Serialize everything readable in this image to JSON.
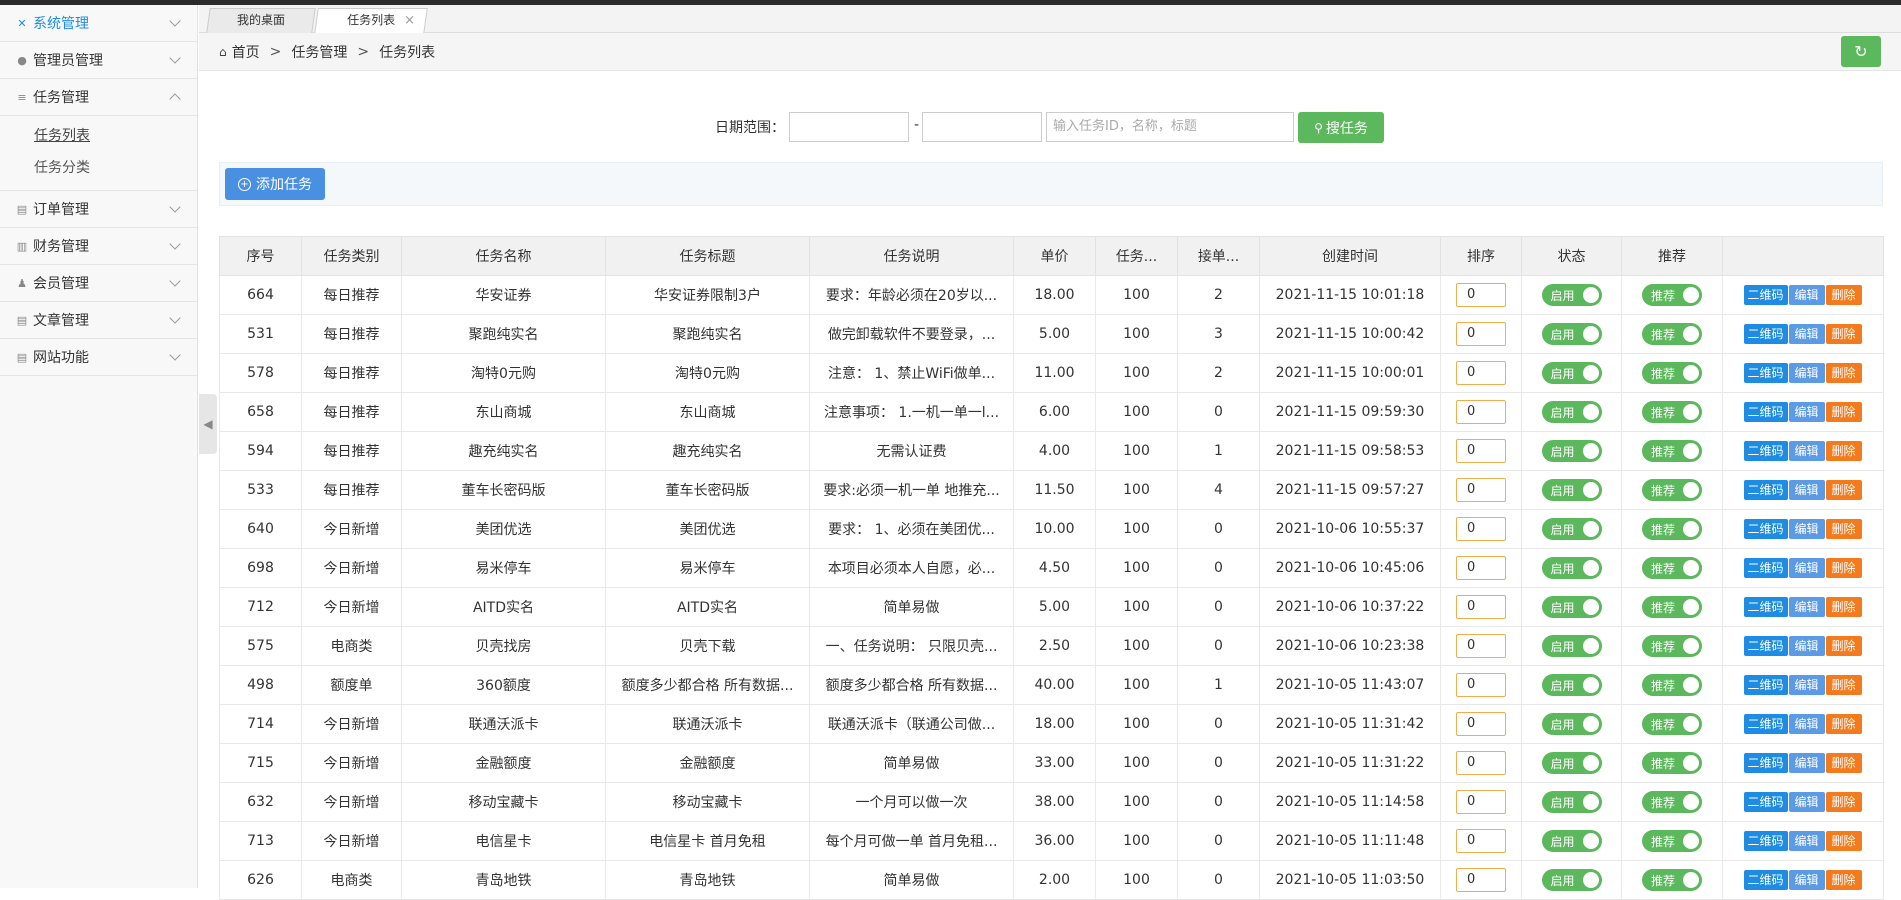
{
  "sidebar": {
    "items": [
      {
        "label": "系统管理",
        "icon": "wrench-icon",
        "expanded": false,
        "active": true
      },
      {
        "label": "管理员管理",
        "icon": "user-icon",
        "expanded": false
      },
      {
        "label": "任务管理",
        "icon": "database-icon",
        "expanded": true,
        "children": [
          {
            "label": "任务列表"
          },
          {
            "label": "任务分类"
          }
        ]
      },
      {
        "label": "订单管理",
        "icon": "table-icon",
        "expanded": false
      },
      {
        "label": "财务管理",
        "icon": "book-icon",
        "expanded": false
      },
      {
        "label": "会员管理",
        "icon": "users-icon",
        "expanded": false
      },
      {
        "label": "文章管理",
        "icon": "list-icon",
        "expanded": false
      },
      {
        "label": "网站功能",
        "icon": "list-icon",
        "expanded": false
      }
    ]
  },
  "tabs": [
    {
      "label": "我的桌面"
    },
    {
      "label": "任务列表",
      "close": "×"
    }
  ],
  "breadcrumb": {
    "home": "首页",
    "sep": ">",
    "section": "任务管理",
    "page": "任务列表"
  },
  "search": {
    "date_label": "日期范围：",
    "dash": "-",
    "keyword_placeholder": "输入任务ID，名称，标题",
    "button_label": "搜任务"
  },
  "toolbar": {
    "add_label": "添加任务"
  },
  "table": {
    "headers": [
      "序号",
      "任务类别",
      "任务名称",
      "任务标题",
      "任务说明",
      "单价",
      "任务...",
      "接单...",
      "创建时间",
      "排序",
      "状态",
      "推荐",
      ""
    ],
    "status_label": "启用",
    "recommend_label": "推荐",
    "actions": {
      "qr": "二维码",
      "edit": "编辑",
      "delete": "删除"
    },
    "rows": [
      [
        "664",
        "每日推荐",
        "华安证券",
        "华安证券限制3户",
        "要求：年龄必须在20岁以...",
        "18.00",
        "100",
        "2",
        "2021-11-15 10:01:18",
        "0"
      ],
      [
        "531",
        "每日推荐",
        "聚跑纯实名",
        "聚跑纯实名",
        "做完卸载软件不要登录，...",
        "5.00",
        "100",
        "3",
        "2021-11-15 10:00:42",
        "0"
      ],
      [
        "578",
        "每日推荐",
        "淘特0元购",
        "淘特0元购",
        "注意：  1、禁止WiFi做单...",
        "11.00",
        "100",
        "2",
        "2021-11-15 10:00:01",
        "0"
      ],
      [
        "658",
        "每日推荐",
        "东山商城",
        "东山商城",
        "注意事项：  1.一机一单一l...",
        "6.00",
        "100",
        "0",
        "2021-11-15 09:59:30",
        "0"
      ],
      [
        "594",
        "每日推荐",
        "趣充纯实名",
        "趣充纯实名",
        "无需认证费",
        "4.00",
        "100",
        "1",
        "2021-11-15 09:58:53",
        "0"
      ],
      [
        "533",
        "每日推荐",
        "董车长密码版",
        "董车长密码版",
        "要求:必须一机一单 地推充...",
        "11.50",
        "100",
        "4",
        "2021-11-15 09:57:27",
        "0"
      ],
      [
        "640",
        "今日新增",
        "美团优选",
        "美团优选",
        "要求：  1、必须在美团优...",
        "10.00",
        "100",
        "0",
        "2021-10-06 10:55:37",
        "0"
      ],
      [
        "698",
        "今日新增",
        "易米停车",
        "易米停车",
        "本项目必须本人自愿，必...",
        "4.50",
        "100",
        "0",
        "2021-10-06 10:45:06",
        "0"
      ],
      [
        "712",
        "今日新增",
        "AITD实名",
        "AITD实名",
        "简单易做",
        "5.00",
        "100",
        "0",
        "2021-10-06 10:37:22",
        "0"
      ],
      [
        "575",
        "电商类",
        "贝壳找房",
        "贝壳下载",
        "一、任务说明：  只限贝壳...",
        "2.50",
        "100",
        "0",
        "2021-10-06 10:23:38",
        "0"
      ],
      [
        "498",
        "额度单",
        "360额度",
        "额度多少都合格 所有数据...",
        "额度多少都合格 所有数据...",
        "40.00",
        "100",
        "1",
        "2021-10-05 11:43:07",
        "0"
      ],
      [
        "714",
        "今日新增",
        "联通沃派卡",
        "联通沃派卡",
        "联通沃派卡（联通公司做...",
        "18.00",
        "100",
        "0",
        "2021-10-05 11:31:42",
        "0"
      ],
      [
        "715",
        "今日新增",
        "金融额度",
        "金融额度",
        "简单易做",
        "33.00",
        "100",
        "0",
        "2021-10-05 11:31:22",
        "0"
      ],
      [
        "632",
        "今日新增",
        "移动宝藏卡",
        "移动宝藏卡",
        "一个月可以做一次",
        "38.00",
        "100",
        "0",
        "2021-10-05 11:14:58",
        "0"
      ],
      [
        "713",
        "今日新增",
        "电信星卡",
        "电信星卡 首月免租",
        "每个月可做一单 首月免租...",
        "36.00",
        "100",
        "0",
        "2021-10-05 11:11:48",
        "0"
      ],
      [
        "626",
        "电商类",
        "青岛地铁",
        "青岛地铁",
        "简单易做",
        "2.00",
        "100",
        "0",
        "2021-10-05 11:03:50",
        "0"
      ]
    ]
  },
  "colors": {
    "green": "#5cb85c",
    "blue": "#1e8ce3",
    "orange": "#f37b1d",
    "sidebar_active": "#1e8ce3"
  }
}
